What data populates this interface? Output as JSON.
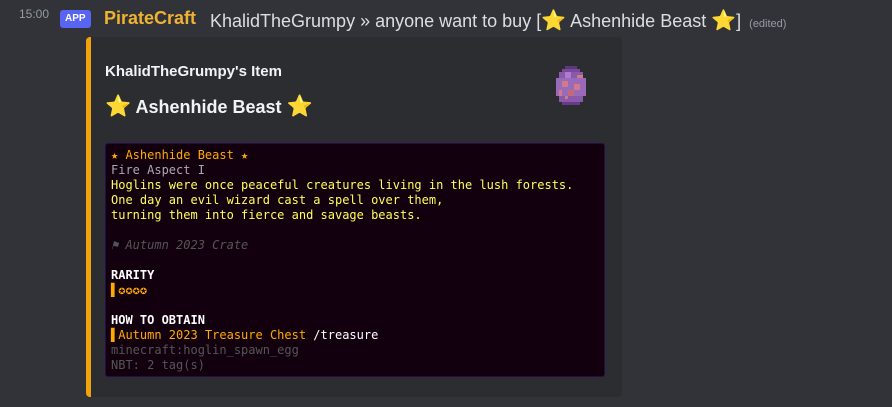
{
  "message": {
    "timestamp": "15:00",
    "badge": "APP",
    "author": "PirateCraft",
    "content_prefix": "KhalidTheGrumpy » anyone want to buy [",
    "content_star_left": "⭐",
    "content_item": " Ashenhide Beast ",
    "content_star_right": "⭐",
    "content_suffix": "]",
    "edited": "(edited)"
  },
  "embed": {
    "accent_color": "#f0a30a",
    "title": "KhalidTheGrumpy's Item",
    "name_star_left": "⭐",
    "name": "Ashenhide Beast",
    "name_star_right": "⭐",
    "thumbnail_icon": "hoglin-spawn-egg-icon"
  },
  "tooltip": {
    "item_name": "★ Ashenhide Beast ★",
    "enchant": "Fire Aspect I",
    "lore": [
      "Hoglins were once peaceful creatures living in the lush forests.",
      "One day an evil wizard cast a spell over them,",
      "turning them into fierce and savage beasts."
    ],
    "crate": "⚑ Autumn 2023 Crate",
    "rarity_header": "RARITY",
    "rarity_value": "▌✪✪✪✪",
    "obtain_header": "HOW TO OBTAIN",
    "obtain_source": "▌Autumn 2023 Treasure Chest",
    "obtain_command": " /treasure",
    "item_id": "minecraft:hoglin_spawn_egg",
    "nbt": "NBT: 2 tag(s)"
  }
}
